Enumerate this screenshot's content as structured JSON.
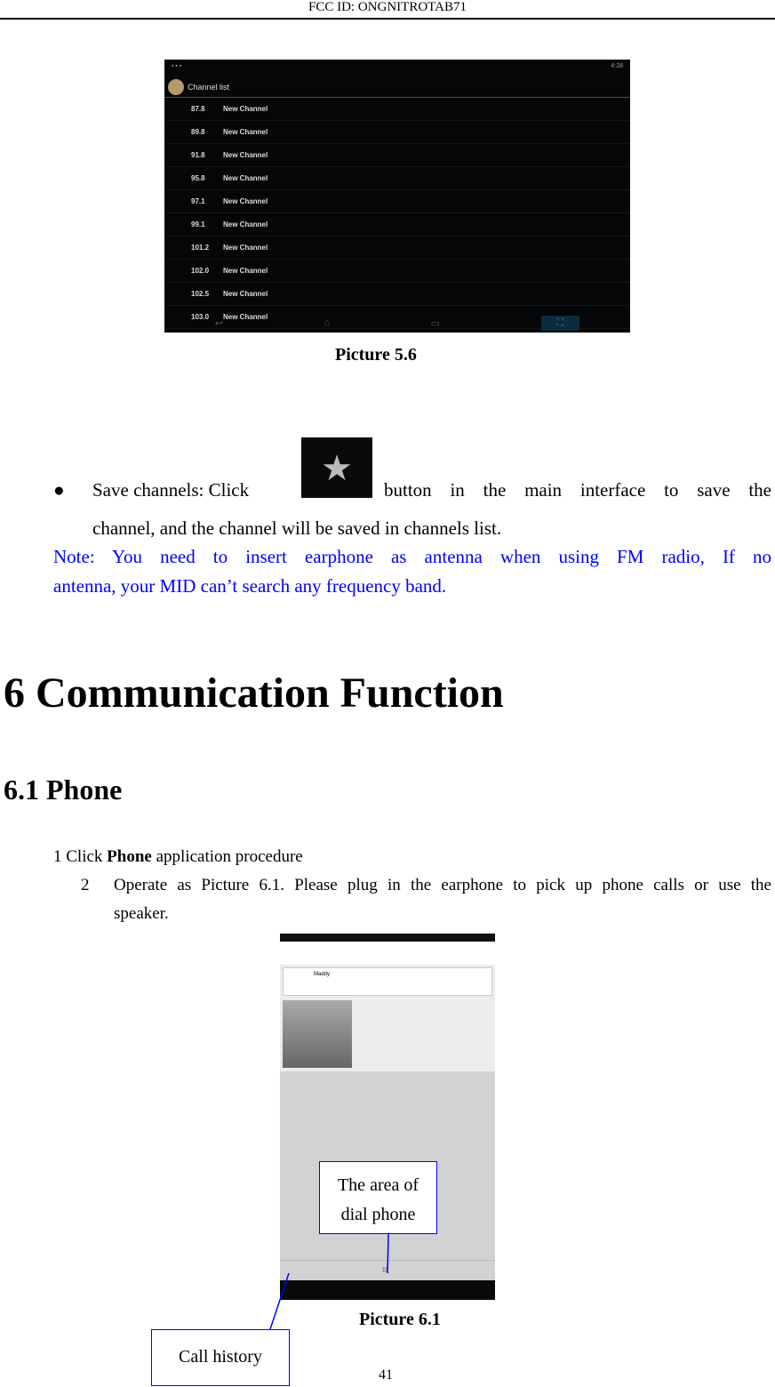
{
  "header": {
    "fcc_id": "FCC ID: ONGNITROTAB71"
  },
  "picture_5_6": {
    "app_title": "Channel list",
    "channels": [
      {
        "freq": "87.8",
        "name": "New Channel"
      },
      {
        "freq": "89.8",
        "name": "New Channel"
      },
      {
        "freq": "91.8",
        "name": "New Channel"
      },
      {
        "freq": "95.8",
        "name": "New Channel"
      },
      {
        "freq": "97.1",
        "name": "New Channel"
      },
      {
        "freq": "99.1",
        "name": "New Channel"
      },
      {
        "freq": "101.2",
        "name": "New Channel"
      },
      {
        "freq": "102.0",
        "name": "New Channel"
      },
      {
        "freq": "102.5",
        "name": "New Channel"
      },
      {
        "freq": "103.0",
        "name": "New Channel"
      }
    ],
    "status_time": "4:28",
    "caption": "Picture 5.6"
  },
  "save_channels": {
    "bullet": "●",
    "part1": "Save  channels:  Click",
    "part2": "button  in  the  main  interface  to  save  the",
    "line2": "channel, and the channel will be saved in channels list.",
    "icon": "star-icon"
  },
  "note": {
    "line1": "Note:  You  need  to  insert  earphone  as  antenna  when  using  FM  radio,  If  no",
    "line2": "antenna, your MID can’t search any frequency band.",
    "color": "#0000ff"
  },
  "chapter_title": "6 Communication Function",
  "section_title": "6.1 Phone",
  "steps": {
    "step1_prefix": "1 Click ",
    "step1_bold": "Phone",
    "step1_suffix": " application procedure",
    "step2_num": "2",
    "step2_line1": "Operate as Picture 6.1. Please plug in the earphone to pick up phone calls or use the",
    "step2_line2": "speaker."
  },
  "picture_6_1": {
    "contact_name": "Maddy",
    "callout_dial_line1": "The area of",
    "callout_dial_line2": "dial phone",
    "callout_history": "Call history",
    "caption": "Picture 6.1"
  },
  "page_number": "41"
}
